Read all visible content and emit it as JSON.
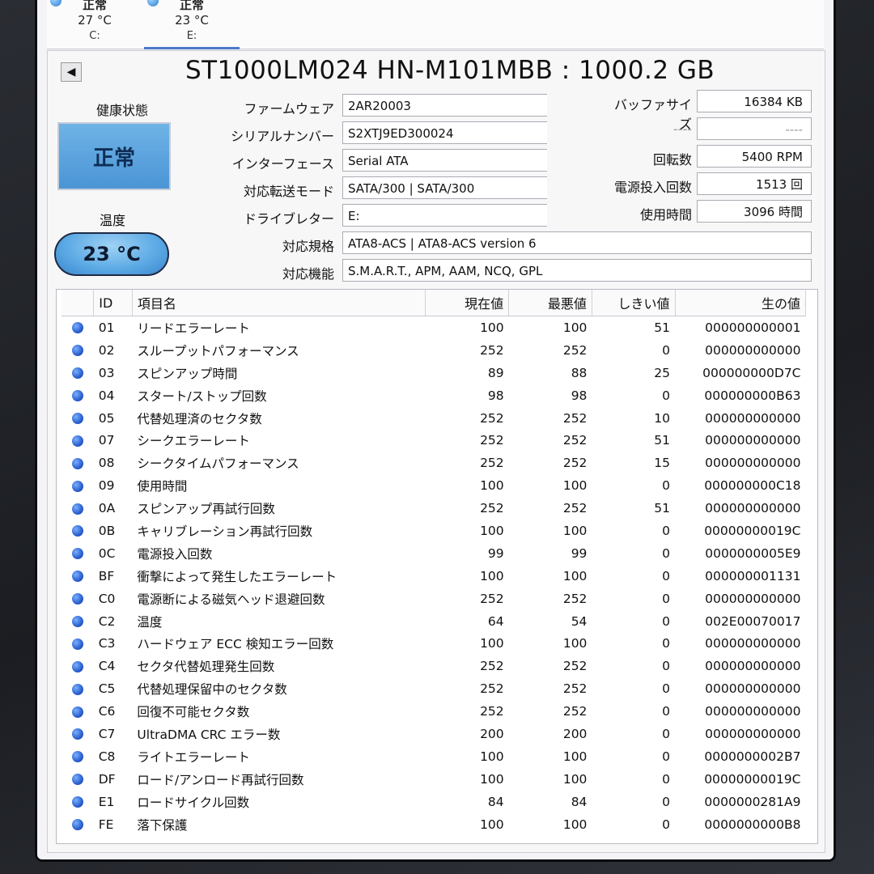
{
  "tabs": [
    {
      "status": "正常",
      "temp": "27 °C",
      "letter": "C:"
    },
    {
      "status": "正常",
      "temp": "23 °C",
      "letter": "E:"
    }
  ],
  "title": "ST1000LM024 HN-M101MBB : 1000.2 GB",
  "health": {
    "label": "健康状態",
    "status": "正常"
  },
  "temperature": {
    "label": "温度",
    "value": "23 °C"
  },
  "info": {
    "firmware_label": "ファームウェア",
    "firmware": "2AR20003",
    "serial_label": "シリアルナンバー",
    "serial": "S2XTJ9ED300024",
    "interface_label": "インターフェース",
    "interface": "Serial ATA",
    "transfer_label": "対応転送モード",
    "transfer": "SATA/300 | SATA/300",
    "drive_letter_label": "ドライブレター",
    "drive_letter": "E:",
    "standard_label": "対応規格",
    "standard": "ATA8-ACS | ATA8-ACS version 6",
    "features_label": "対応機能",
    "features": "S.M.A.R.T., APM, AAM, NCQ, GPL"
  },
  "right_info": {
    "buffer_label": "バッファサイズ",
    "buffer": "16384 KB",
    "blank_label": "----",
    "blank": "----",
    "rpm_label": "回転数",
    "rpm": "5400 RPM",
    "power_count_label": "電源投入回数",
    "power_count": "1513 回",
    "hours_label": "使用時間",
    "hours": "3096 時間"
  },
  "smart_headers": {
    "id": "ID",
    "name": "項目名",
    "current": "現在値",
    "worst": "最悪値",
    "threshold": "しきい値",
    "raw": "生の値"
  },
  "smart_rows": [
    {
      "id": "01",
      "name": "リードエラーレート",
      "current": "100",
      "worst": "100",
      "threshold": "51",
      "raw": "000000000001"
    },
    {
      "id": "02",
      "name": "スループットパフォーマンス",
      "current": "252",
      "worst": "252",
      "threshold": "0",
      "raw": "000000000000"
    },
    {
      "id": "03",
      "name": "スピンアップ時間",
      "current": "89",
      "worst": "88",
      "threshold": "25",
      "raw": "000000000D7C"
    },
    {
      "id": "04",
      "name": "スタート/ストップ回数",
      "current": "98",
      "worst": "98",
      "threshold": "0",
      "raw": "000000000B63"
    },
    {
      "id": "05",
      "name": "代替処理済のセクタ数",
      "current": "252",
      "worst": "252",
      "threshold": "10",
      "raw": "000000000000"
    },
    {
      "id": "07",
      "name": "シークエラーレート",
      "current": "252",
      "worst": "252",
      "threshold": "51",
      "raw": "000000000000"
    },
    {
      "id": "08",
      "name": "シークタイムパフォーマンス",
      "current": "252",
      "worst": "252",
      "threshold": "15",
      "raw": "000000000000"
    },
    {
      "id": "09",
      "name": "使用時間",
      "current": "100",
      "worst": "100",
      "threshold": "0",
      "raw": "000000000C18"
    },
    {
      "id": "0A",
      "name": "スピンアップ再試行回数",
      "current": "252",
      "worst": "252",
      "threshold": "51",
      "raw": "000000000000"
    },
    {
      "id": "0B",
      "name": "キャリブレーション再試行回数",
      "current": "100",
      "worst": "100",
      "threshold": "0",
      "raw": "00000000019C"
    },
    {
      "id": "0C",
      "name": "電源投入回数",
      "current": "99",
      "worst": "99",
      "threshold": "0",
      "raw": "0000000005E9"
    },
    {
      "id": "BF",
      "name": "衝撃によって発生したエラーレート",
      "current": "100",
      "worst": "100",
      "threshold": "0",
      "raw": "000000001131"
    },
    {
      "id": "C0",
      "name": "電源断による磁気ヘッド退避回数",
      "current": "252",
      "worst": "252",
      "threshold": "0",
      "raw": "000000000000"
    },
    {
      "id": "C2",
      "name": "温度",
      "current": "64",
      "worst": "54",
      "threshold": "0",
      "raw": "002E00070017"
    },
    {
      "id": "C3",
      "name": "ハードウェア ECC 検知エラー回数",
      "current": "100",
      "worst": "100",
      "threshold": "0",
      "raw": "000000000000"
    },
    {
      "id": "C4",
      "name": "セクタ代替処理発生回数",
      "current": "252",
      "worst": "252",
      "threshold": "0",
      "raw": "000000000000"
    },
    {
      "id": "C5",
      "name": "代替処理保留中のセクタ数",
      "current": "252",
      "worst": "252",
      "threshold": "0",
      "raw": "000000000000"
    },
    {
      "id": "C6",
      "name": "回復不可能セクタ数",
      "current": "252",
      "worst": "252",
      "threshold": "0",
      "raw": "000000000000"
    },
    {
      "id": "C7",
      "name": "UltraDMA CRC エラー数",
      "current": "200",
      "worst": "200",
      "threshold": "0",
      "raw": "000000000000"
    },
    {
      "id": "C8",
      "name": "ライトエラーレート",
      "current": "100",
      "worst": "100",
      "threshold": "0",
      "raw": "0000000002B7"
    },
    {
      "id": "DF",
      "name": "ロード/アンロード再試行回数",
      "current": "100",
      "worst": "100",
      "threshold": "0",
      "raw": "00000000019C"
    },
    {
      "id": "E1",
      "name": "ロードサイクル回数",
      "current": "84",
      "worst": "84",
      "threshold": "0",
      "raw": "0000000281A9"
    },
    {
      "id": "FE",
      "name": "落下保護",
      "current": "100",
      "worst": "100",
      "threshold": "0",
      "raw": "0000000000B8"
    }
  ],
  "colors": {
    "health_good": "#4b95d6",
    "status_dot": "#2a5fcf",
    "accent": "#4c79c8"
  }
}
